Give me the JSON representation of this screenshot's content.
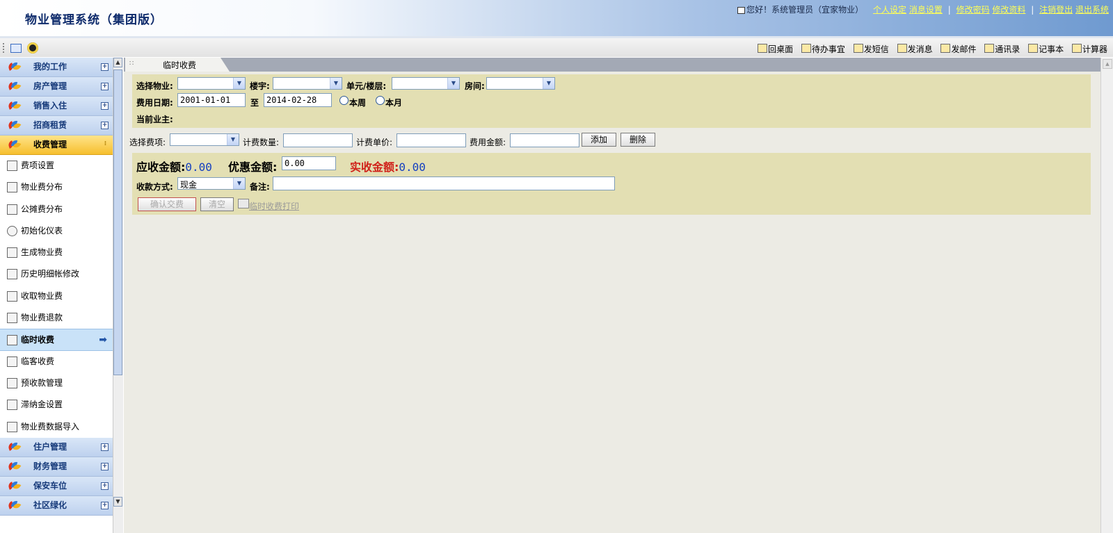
{
  "app": {
    "title": "物业管理系统（集团版）",
    "greeting": "您好！系统管理员（宜家物业）",
    "links": [
      "个人设定",
      "消息设置",
      "修改密码",
      "修改资料",
      "注销登出",
      "退出系统"
    ]
  },
  "toolbar": {
    "items": [
      "回桌面",
      "待办事宜",
      "发短信",
      "发消息",
      "发邮件",
      "通讯录",
      "记事本",
      "计算器"
    ]
  },
  "sidebar": {
    "groups_top": [
      "我的工作",
      "房产管理",
      "销售入住",
      "招商租赁"
    ],
    "active_group": "收费管理",
    "sub_items": [
      {
        "label": "费项设置",
        "icon": "settings-doc-icon"
      },
      {
        "label": "物业费分布",
        "icon": "grid-icon"
      },
      {
        "label": "公摊费分布",
        "icon": "grid-icon"
      },
      {
        "label": "初始化仪表",
        "icon": "gauge-icon"
      },
      {
        "label": "生成物业费",
        "icon": "document-icon"
      },
      {
        "label": "历史明细帐修改",
        "icon": "edit-doc-icon"
      },
      {
        "label": "收取物业费",
        "icon": "receive-icon"
      },
      {
        "label": "物业费退款",
        "icon": "refund-icon"
      },
      {
        "label": "临时收费",
        "icon": "edit-icon",
        "current": true
      },
      {
        "label": "临客收费",
        "icon": "edit-icon"
      },
      {
        "label": "预收款管理",
        "icon": "money-icon"
      },
      {
        "label": "滞纳金设置",
        "icon": "medal-icon"
      },
      {
        "label": "物业费数据导入",
        "icon": "import-icon"
      }
    ],
    "groups_bottom": [
      "住户管理",
      "财务管理",
      "保安车位",
      "社区绿化"
    ]
  },
  "tab": {
    "label": "临时收费"
  },
  "filter": {
    "property_label": "选择物业:",
    "building_label": "楼宇:",
    "unit_label": "单元/楼层:",
    "room_label": "房间:",
    "date_label": "费用日期:",
    "date_from": "2001-01-01",
    "to_label": "至",
    "date_to": "2014-02-28",
    "week_label": "本周",
    "month_label": "本月",
    "owner_label": "当前业主:"
  },
  "fee_row": {
    "item_label": "选择费项:",
    "qty_label": "计费数量:",
    "price_label": "计费单价:",
    "amount_label": "费用金额:",
    "add_button": "添加",
    "delete_button": "删除"
  },
  "payment": {
    "receivable_label": "应收金额:",
    "receivable_value": "0.00",
    "discount_label": "优惠金额:",
    "discount_value": "0.00",
    "actual_label": "实收金额:",
    "actual_value": "0.00",
    "method_label": "收款方式:",
    "method_value": "现金",
    "remark_label": "备注:",
    "confirm_button": "确认交费",
    "clear_button": "清空",
    "print_link": "临时收费打印"
  }
}
